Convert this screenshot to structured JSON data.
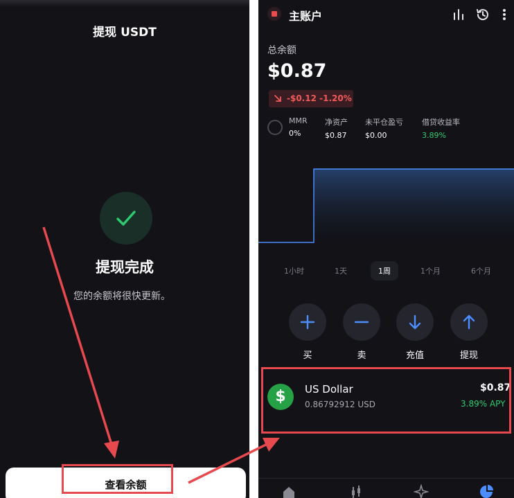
{
  "left": {
    "title": "提现 USDT",
    "status_title": "提现完成",
    "status_subtitle": "您的余额将很快更新。",
    "primary_button": "查看余额"
  },
  "right": {
    "account_title": "主账户",
    "balance_label": "总余额",
    "balance_value": "$0.87",
    "change_text": "-$0.12 -1.20%",
    "stats": [
      {
        "label": "MMR",
        "value": "0%"
      },
      {
        "label": "净资产",
        "value": "$0.87"
      },
      {
        "label": "未平仓盈亏",
        "value": "$0.00"
      },
      {
        "label": "借贷收益率",
        "value": "3.89%"
      }
    ],
    "timeframes": [
      "1小时",
      "1天",
      "1周",
      "1个月",
      "6个月"
    ],
    "active_timeframe": "1周",
    "actions": [
      {
        "label": "买",
        "icon": "plus-icon"
      },
      {
        "label": "卖",
        "icon": "minus-icon"
      },
      {
        "label": "充值",
        "icon": "arrow-down-icon"
      },
      {
        "label": "提现",
        "icon": "arrow-up-icon"
      }
    ],
    "asset": {
      "name": "US Dollar",
      "amount": "0.86792912 USD",
      "value": "$0.87",
      "apy": "3.89% APY",
      "icon": "dollar-icon"
    },
    "nav_icons": [
      "home-icon",
      "trade-icon",
      "sparkle-icon",
      "portfolio-pie-icon"
    ]
  },
  "colors": {
    "background": "#121217",
    "accent_green": "#2ecc71",
    "negative_red": "#f05a5a",
    "action_blue": "#4c8dff",
    "annotation_red": "#e64a4f"
  }
}
